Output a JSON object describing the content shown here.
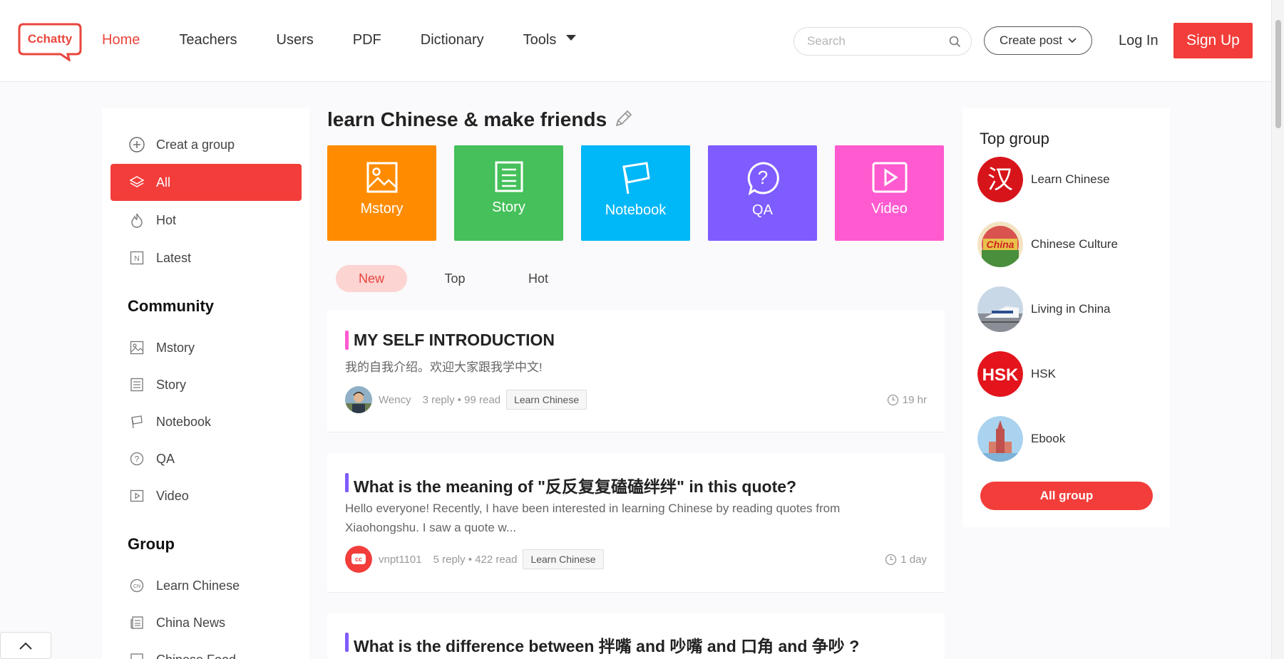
{
  "header": {
    "logo_text": "Cchatty",
    "nav": [
      {
        "label": "Home",
        "active": true
      },
      {
        "label": "Teachers"
      },
      {
        "label": "Users"
      },
      {
        "label": "PDF"
      },
      {
        "label": "Dictionary"
      },
      {
        "label": "Tools"
      }
    ],
    "search_placeholder": "Search",
    "create_post": "Create post",
    "login": "Log In",
    "signup": "Sign Up",
    "accent": "#f23d3a"
  },
  "sidebar": {
    "top_items": [
      {
        "label": "Creat a group",
        "icon": "plus-circle-icon"
      },
      {
        "label": "All",
        "icon": "layers-icon",
        "active": true
      },
      {
        "label": "Hot",
        "icon": "flame-icon"
      },
      {
        "label": "Latest",
        "icon": "new-icon"
      }
    ],
    "community_heading": "Community",
    "community_items": [
      {
        "label": "Mstory",
        "icon": "image-icon"
      },
      {
        "label": "Story",
        "icon": "list-icon"
      },
      {
        "label": "Notebook",
        "icon": "flag-icon"
      },
      {
        "label": "QA",
        "icon": "question-icon"
      },
      {
        "label": "Video",
        "icon": "video-icon"
      }
    ],
    "group_heading": "Group",
    "group_items": [
      {
        "label": "Learn Chinese",
        "icon": "cn-icon"
      },
      {
        "label": "China News",
        "icon": "news-icon"
      },
      {
        "label": "Chinese Food",
        "icon": "food-icon"
      }
    ]
  },
  "main": {
    "title": "learn Chinese & make friends",
    "tiles": [
      {
        "label": "Mstory",
        "color": "#ff8c00",
        "icon": "image-icon"
      },
      {
        "label": "Story",
        "color": "#45c05a",
        "icon": "list-icon"
      },
      {
        "label": "Notebook",
        "color": "#00b7f7",
        "icon": "flag-icon"
      },
      {
        "label": "QA",
        "color": "#7f5cff",
        "icon": "question-icon"
      },
      {
        "label": "Video",
        "color": "#ff5ad0",
        "icon": "video-icon"
      }
    ],
    "tabs": [
      {
        "label": "New",
        "active": true
      },
      {
        "label": "Top"
      },
      {
        "label": "Hot"
      }
    ],
    "posts": [
      {
        "title": "MY SELF INTRODUCTION",
        "excerpt": "我的自我介绍。欢迎大家跟我学中文!",
        "author": "Wency",
        "stats": "3 reply • 99 read",
        "tag": "Learn Chinese",
        "time": "19 hr",
        "bar_color": "#ff5ad0"
      },
      {
        "title": "What is the meaning of \"反反复复磕磕绊绊\" in this quote?",
        "excerpt": "Hello everyone! Recently, I have been interested in learning Chinese by reading quotes from Xiaohongshu. I saw a quote w...",
        "author": "vnpt1101",
        "stats": "5 reply • 422 read",
        "tag": "Learn Chinese",
        "time": "1 day",
        "bar_color": "#7f5cff"
      },
      {
        "title": "What is the difference between 拌嘴 and 吵嘴 and 口角 and 争吵 ?",
        "bar_color": "#7f5cff"
      }
    ]
  },
  "right": {
    "heading": "Top group",
    "groups": [
      {
        "name": "Learn Chinese",
        "image_text": "汉"
      },
      {
        "name": "Chinese Culture",
        "image_text": "China"
      },
      {
        "name": "Living in China"
      },
      {
        "name": "HSK",
        "image_text": "HSK"
      },
      {
        "name": "Ebook"
      }
    ],
    "all_group": "All group"
  }
}
